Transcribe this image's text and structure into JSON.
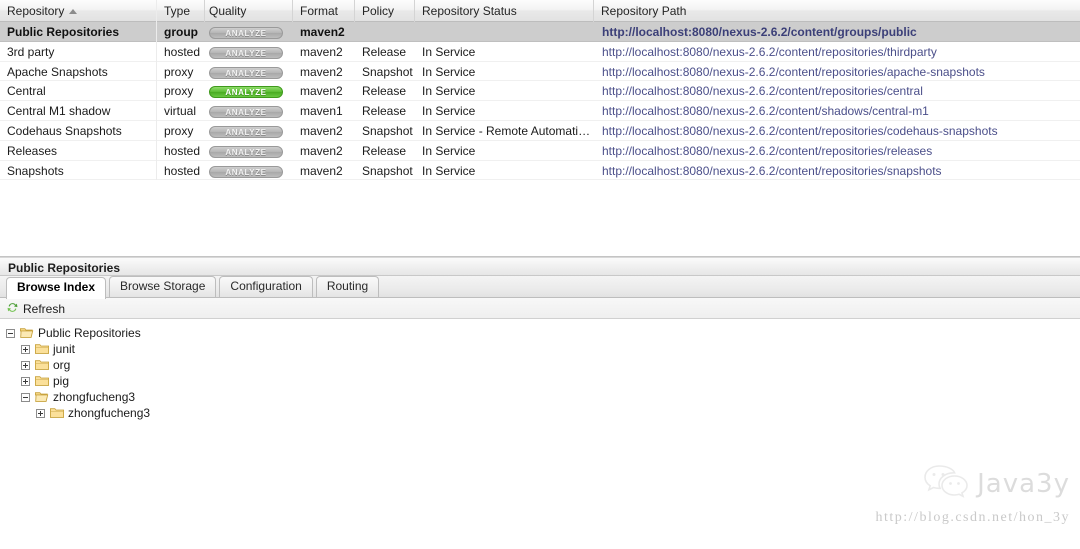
{
  "grid": {
    "columns": [
      {
        "key": "repository",
        "label": "Repository",
        "sorted": "asc"
      },
      {
        "key": "type",
        "label": "Type"
      },
      {
        "key": "quality",
        "label": "Quality"
      },
      {
        "key": "format",
        "label": "Format"
      },
      {
        "key": "policy",
        "label": "Policy"
      },
      {
        "key": "status",
        "label": "Repository Status"
      },
      {
        "key": "path",
        "label": "Repository Path"
      }
    ],
    "analyze_label": "ANALYZE",
    "rows": [
      {
        "repository": "Public Repositories",
        "type": "group",
        "quality": "ANALYZE",
        "quality_state": "gray",
        "format": "maven2",
        "policy": "",
        "status": "",
        "path": "http://localhost:8080/nexus-2.6.2/content/groups/public",
        "selected": true
      },
      {
        "repository": "3rd party",
        "type": "hosted",
        "quality": "ANALYZE",
        "quality_state": "gray",
        "format": "maven2",
        "policy": "Release",
        "status": "In Service",
        "path": "http://localhost:8080/nexus-2.6.2/content/repositories/thirdparty",
        "selected": false
      },
      {
        "repository": "Apache Snapshots",
        "type": "proxy",
        "quality": "ANALYZE",
        "quality_state": "gray",
        "format": "maven2",
        "policy": "Snapshot",
        "status": "In Service",
        "path": "http://localhost:8080/nexus-2.6.2/content/repositories/apache-snapshots",
        "selected": false
      },
      {
        "repository": "Central",
        "type": "proxy",
        "quality": "ANALYZE",
        "quality_state": "green",
        "format": "maven2",
        "policy": "Release",
        "status": "In Service",
        "path": "http://localhost:8080/nexus-2.6.2/content/repositories/central",
        "selected": false
      },
      {
        "repository": "Central M1 shadow",
        "type": "virtual",
        "quality": "ANALYZE",
        "quality_state": "gray",
        "format": "maven1",
        "policy": "Release",
        "status": "In Service",
        "path": "http://localhost:8080/nexus-2.6.2/content/shadows/central-m1",
        "selected": false
      },
      {
        "repository": "Codehaus Snapshots",
        "type": "proxy",
        "quality": "ANALYZE",
        "quality_state": "gray",
        "format": "maven2",
        "policy": "Snapshot",
        "status": "In Service - Remote Automaticall…",
        "path": "http://localhost:8080/nexus-2.6.2/content/repositories/codehaus-snapshots",
        "selected": false
      },
      {
        "repository": "Releases",
        "type": "hosted",
        "quality": "ANALYZE",
        "quality_state": "gray",
        "format": "maven2",
        "policy": "Release",
        "status": "In Service",
        "path": "http://localhost:8080/nexus-2.6.2/content/repositories/releases",
        "selected": false
      },
      {
        "repository": "Snapshots",
        "type": "hosted",
        "quality": "ANALYZE",
        "quality_state": "gray",
        "format": "maven2",
        "policy": "Snapshot",
        "status": "In Service",
        "path": "http://localhost:8080/nexus-2.6.2/content/repositories/snapshots",
        "selected": false
      }
    ]
  },
  "detail": {
    "title": "Public Repositories",
    "tabs": [
      {
        "label": "Browse Index",
        "active": true
      },
      {
        "label": "Browse Storage",
        "active": false
      },
      {
        "label": "Configuration",
        "active": false
      },
      {
        "label": "Routing",
        "active": false
      }
    ],
    "toolbar": {
      "refresh_label": "Refresh",
      "refresh_icon": "refresh-icon"
    },
    "tree": [
      {
        "label": "Public Repositories",
        "depth": 0,
        "toggle": "minus",
        "folder": "open"
      },
      {
        "label": "junit",
        "depth": 1,
        "toggle": "plus",
        "folder": "closed"
      },
      {
        "label": "org",
        "depth": 1,
        "toggle": "plus",
        "folder": "closed"
      },
      {
        "label": "pig",
        "depth": 1,
        "toggle": "plus",
        "folder": "closed"
      },
      {
        "label": "zhongfucheng3",
        "depth": 1,
        "toggle": "minus",
        "folder": "open"
      },
      {
        "label": "zhongfucheng3",
        "depth": 2,
        "toggle": "plus",
        "folder": "closed"
      }
    ]
  },
  "watermark": {
    "brand": "Java3y",
    "url": "http://blog.csdn.net/hon_3y",
    "icon": "wechat-icon"
  },
  "colors": {
    "selected_row": "#cdcdcd",
    "link": "#4b4f8a",
    "analyze_green": "#5dbd35",
    "analyze_gray": "#b6b6b6"
  }
}
